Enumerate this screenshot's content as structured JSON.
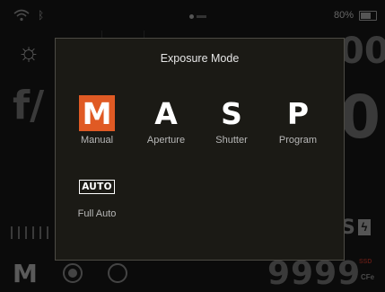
{
  "status": {
    "battery_pct": "80%",
    "bt_icon": "bluetooth-icon"
  },
  "background": {
    "aperture_prefix": "f/",
    "shutter_partial": "00",
    "iso_partial": "0",
    "focus_indicator": "S",
    "flash_icon": "ϟ",
    "mode_letter": "M",
    "shots_remaining": "9999",
    "card_ssd": "SSD",
    "card_type": "CFe"
  },
  "dialog": {
    "title": "Exposure Mode",
    "modes": [
      {
        "letter": "M",
        "label": "Manual",
        "selected": true
      },
      {
        "letter": "A",
        "label": "Aperture",
        "selected": false
      },
      {
        "letter": "S",
        "label": "Shutter",
        "selected": false
      },
      {
        "letter": "P",
        "label": "Program",
        "selected": false
      }
    ],
    "auto": {
      "badge": "AUTO",
      "label": "Full Auto"
    }
  },
  "colors": {
    "accent": "#e05a24",
    "panel": "#1b1a15"
  }
}
